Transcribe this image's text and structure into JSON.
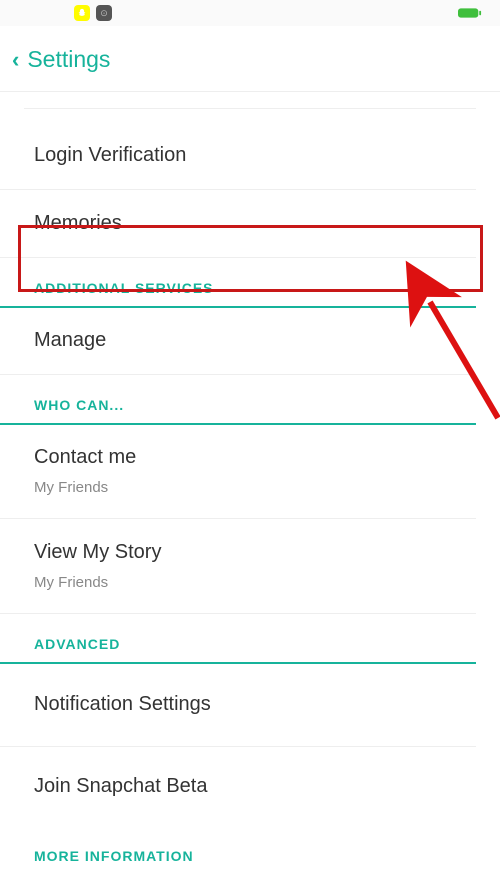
{
  "status": {
    "battery_color": "#3fbf3c"
  },
  "nav": {
    "title": "Settings"
  },
  "rows": {
    "login_verification": "Login Verification",
    "memories": "Memories",
    "manage": "Manage",
    "contact_me": {
      "label": "Contact me",
      "value": "My Friends"
    },
    "view_my_story": {
      "label": "View My Story",
      "value": "My Friends"
    },
    "notification_settings": "Notification Settings",
    "join_beta": "Join Snapchat Beta"
  },
  "sections": {
    "additional_services": "ADDITIONAL SERVICES",
    "who_can": "WHO CAN...",
    "advanced": "ADVANCED",
    "more_info": "MORE INFORMATION"
  }
}
